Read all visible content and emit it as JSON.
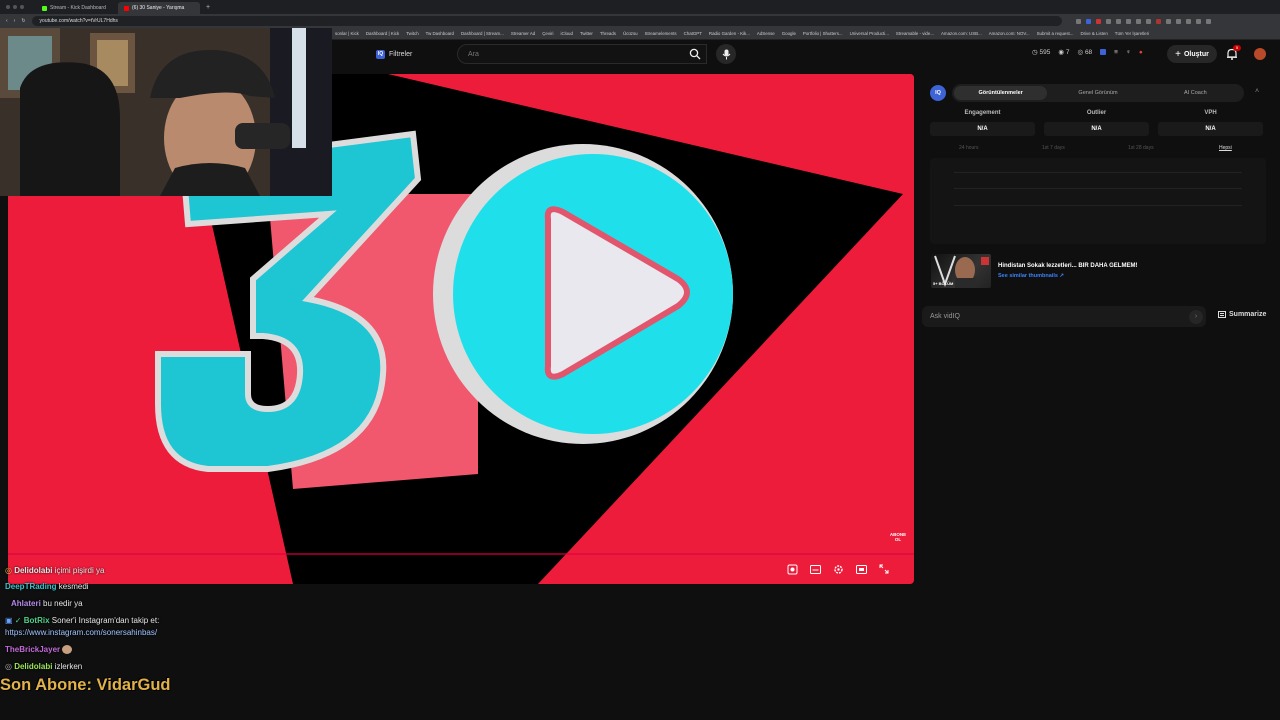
{
  "browser": {
    "tabs": [
      {
        "title": "Stream - Kick Dashboard",
        "color": "#53fc18"
      },
      {
        "title": "(6) 30 Saniye - Yarışma",
        "color": "#ff0000"
      }
    ],
    "url": "youtube.com/watch?v=tVrUL7Hdhs",
    "bookmarks": [
      "sonlar | Kick",
      "Dashboard | Kick",
      "Twitch",
      "Tw Dashboard",
      "Dashboard | Stream...",
      "Streamer Ad",
      "Çeviri",
      "iCloud",
      "Twitter",
      "Threads",
      "Ücüzsu",
      "Streamelements",
      "ChatGPT",
      "Radio Garden - Kik...",
      "AdSense",
      "Google",
      "Portfolio | Shutters...",
      "Universal Producti...",
      "Streamable - vide...",
      "Amazon.com: USB...",
      "Amazon.com: NOV...",
      "Submit a request...",
      "Drive & Listen",
      "Tüm Yer İşaretleri"
    ]
  },
  "header": {
    "filter_label": "Filtreler",
    "filter_icon_text": "IQ",
    "search_placeholder": "Ara",
    "stats": [
      "595",
      "7",
      "68"
    ],
    "create_label": "Oluştur",
    "notification_count": "5"
  },
  "player": {
    "brand_colors": {
      "red": "#ee1c3b",
      "cyan": "#1fe0ea",
      "black": "#000000"
    },
    "big_number": "30",
    "subscribe_badge": "ABONE OL"
  },
  "vidiq": {
    "logo": "IQ",
    "tabs": [
      "Görüntülenmeler",
      "Genel Görünüm",
      "AI Coach"
    ],
    "active_tab": "Görüntülenmeler",
    "metrics": [
      {
        "label": "Engagement",
        "value": "N/A"
      },
      {
        "label": "Outlier",
        "value": "N/A"
      },
      {
        "label": "VPH",
        "value": "N/A"
      }
    ],
    "ranges": [
      "24 hours",
      "1st 7 days",
      "1st 28 days",
      "Hepsi"
    ],
    "active_range": "Hepsi",
    "recommendation": {
      "title": "Hindistan Sokak lezzetleri... BIR DAHA GELMEM!",
      "link": "See similar thumbnails ↗",
      "thumb_text": "5+ BÖLÜM"
    },
    "ask_placeholder": "Ask vidIQ",
    "summarize_label": "Summarize"
  },
  "chat": {
    "lines": [
      {
        "user": "Delidolabi",
        "user_color": "#e6e6e6",
        "text": "içimi pişirdi ya"
      },
      {
        "user": "DeepTRading",
        "user_color": "#3ec1c9",
        "text": "kesmedi"
      },
      {
        "user": "Ahlateri",
        "user_color": "#b38ae8",
        "text": "bu nedir ya"
      },
      {
        "user": "BotRix",
        "user_color": "#4fd18b",
        "text": "Soner'i Instagram'dan takip et:"
      },
      {
        "user": "",
        "user_color": "#ffffff",
        "text": "https://www.instagram.com/sonersahinbas/"
      },
      {
        "user": "TheBrickJayer",
        "user_color": "#c26ad8",
        "text": ""
      },
      {
        "user": "Delidolabi",
        "user_color": "#9be55a",
        "text": "izlerken"
      }
    ],
    "last_sub_label": "Son Abone: VidarGud"
  }
}
